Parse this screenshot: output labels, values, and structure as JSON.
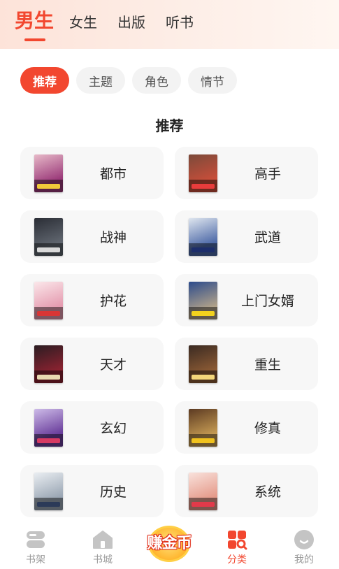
{
  "top_tabs": [
    "男生",
    "女生",
    "出版",
    "听书"
  ],
  "active_top_tab": "男生",
  "chips": [
    "推荐",
    "主题",
    "角色",
    "情节"
  ],
  "active_chip": "推荐",
  "section_title": "推荐",
  "categories": [
    {
      "label": "都市",
      "icon": "book-cover",
      "cover_colors": [
        "#e7b9c8",
        "#9b3a7a",
        "#f0c93a"
      ]
    },
    {
      "label": "高手",
      "icon": "book-cover",
      "cover_colors": [
        "#7b4a3a",
        "#c84e3a",
        "#e83c3c"
      ]
    },
    {
      "label": "战神",
      "icon": "book-cover",
      "cover_colors": [
        "#2a2d35",
        "#60666f",
        "#d9d9d9"
      ]
    },
    {
      "label": "武道",
      "icon": "book-cover",
      "cover_colors": [
        "#dfe6ef",
        "#4e6aa8",
        "#1d2e6b"
      ]
    },
    {
      "label": "护花",
      "icon": "book-cover",
      "cover_colors": [
        "#fbe7ea",
        "#e59bb0",
        "#d93535"
      ]
    },
    {
      "label": "上门女婿",
      "icon": "book-cover",
      "cover_colors": [
        "#2c4b8c",
        "#b0a189",
        "#f3d21e"
      ]
    },
    {
      "label": "天才",
      "icon": "book-cover",
      "cover_colors": [
        "#2b1d22",
        "#8a2230",
        "#e8d9b0"
      ]
    },
    {
      "label": "重生",
      "icon": "book-cover",
      "cover_colors": [
        "#3a2a22",
        "#8b5a34",
        "#f3d67a"
      ]
    },
    {
      "label": "玄幻",
      "icon": "book-cover",
      "cover_colors": [
        "#cdbbe8",
        "#6a3e9c",
        "#d63a63"
      ]
    },
    {
      "label": "修真",
      "icon": "book-cover",
      "cover_colors": [
        "#5c3a22",
        "#c49a52",
        "#f0c21e"
      ]
    },
    {
      "label": "历史",
      "icon": "book-cover",
      "cover_colors": [
        "#eaeef2",
        "#9aa6b4",
        "#2b3a58"
      ]
    },
    {
      "label": "系统",
      "icon": "book-cover",
      "cover_colors": [
        "#f9e2dc",
        "#e59a8a",
        "#e23a4a"
      ]
    }
  ],
  "nav": [
    {
      "label": "书架",
      "icon": "bookshelf-icon"
    },
    {
      "label": "书城",
      "icon": "bookstore-home-icon"
    },
    {
      "label": "分类",
      "icon": "category-icon"
    },
    {
      "label": "我的",
      "icon": "profile-icon"
    }
  ],
  "active_nav": "分类",
  "coin_badge": "赚金币",
  "colors": {
    "accent": "#f2472f",
    "chip_bg": "#f3f3f3",
    "card_bg": "#f7f7f7",
    "nav_inactive": "#b8b8b8"
  }
}
